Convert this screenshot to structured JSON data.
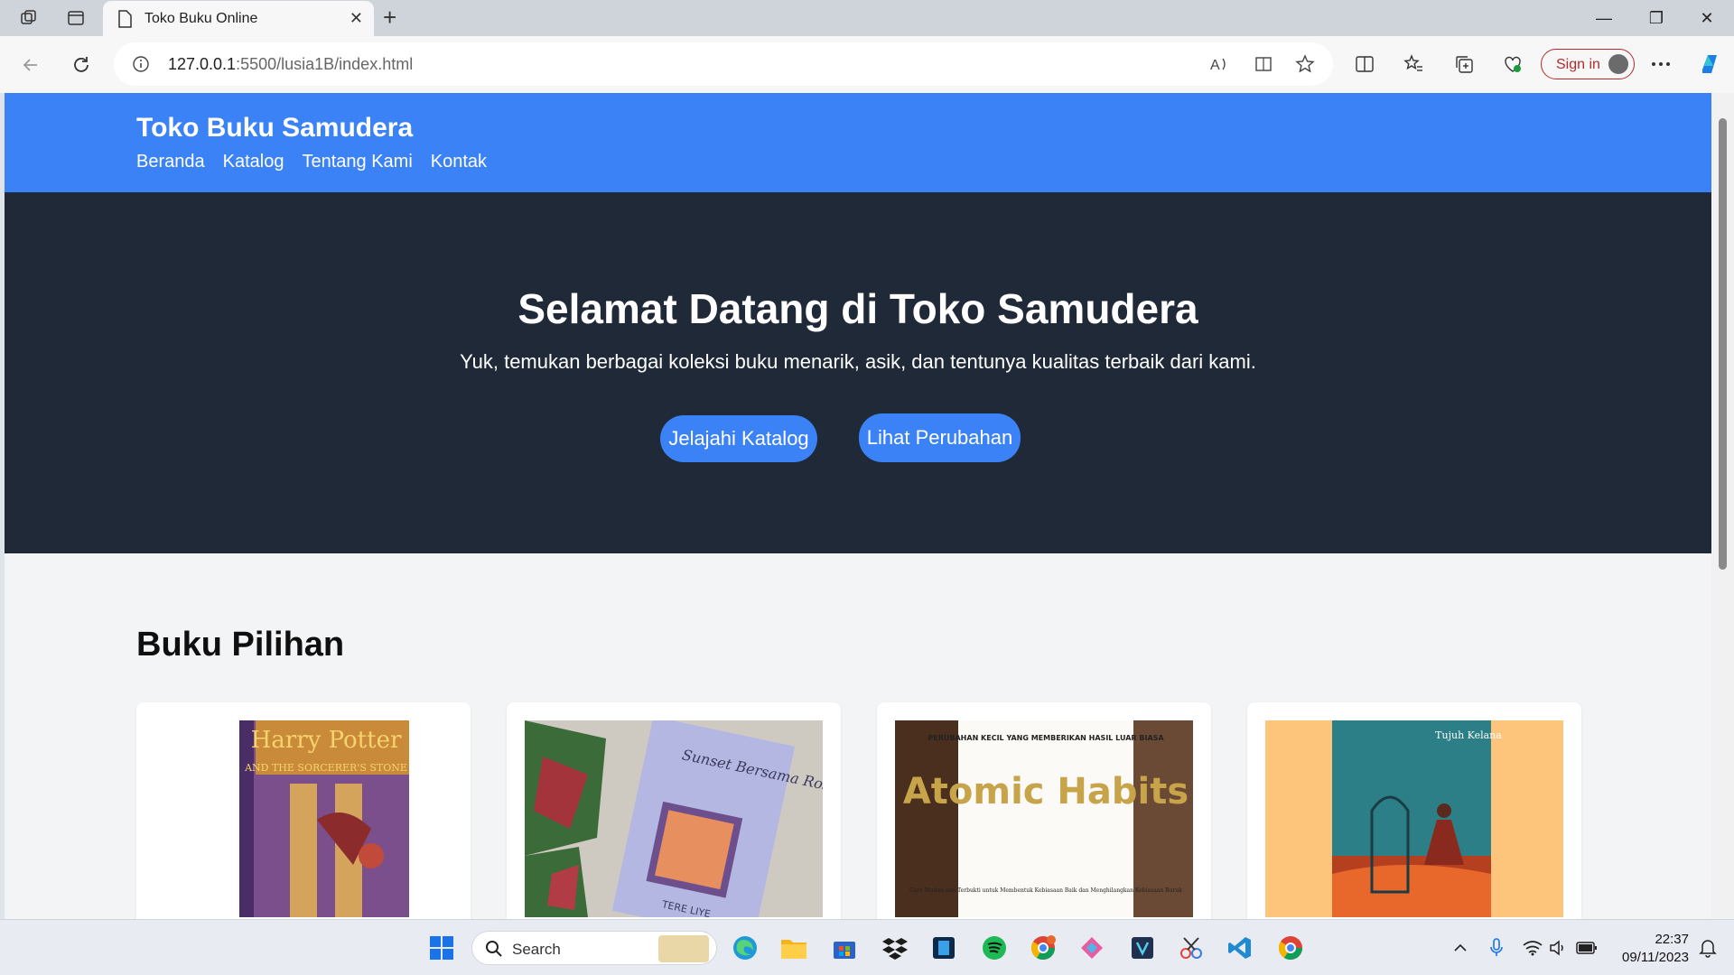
{
  "browser": {
    "tab_title": "Toko Buku Online",
    "url_host": "127.0.0.1",
    "url_rest": ":5500/lusia1B/index.html",
    "signin_label": "Sign in"
  },
  "site": {
    "brand": "Toko Buku Samudera",
    "nav": [
      "Beranda",
      "Katalog",
      "Tentang Kami",
      "Kontak"
    ],
    "hero": {
      "title": "Selamat Datang di Toko Samudera",
      "subtitle": "Yuk, temukan berbagai koleksi buku menarik, asik, dan tentunya kualitas terbaik dari kami.",
      "primary_button": "Jelajahi Katalog",
      "secondary_button": "Lihat Perubahan"
    },
    "section_title": "Buku Pilihan",
    "books": [
      {
        "cover_title": "Harry Potter",
        "cover_subtitle": "AND THE SORCERER'S STONE"
      },
      {
        "cover_title": "Sunset Bersama Rosie",
        "cover_author": "TERE LIYE"
      },
      {
        "cover_tagline": "PERUBAHAN KECIL YANG MEMBERIKAN HASIL LUAR BIASA",
        "cover_title": "Atomic Habits",
        "cover_subtitle": "Cara Mudah dan Terbukti untuk Membentuk Kebiasaan Baik dan Menghilangkan Kebiasaan Buruk"
      },
      {
        "cover_title": "Tujuh Kelana"
      }
    ]
  },
  "taskbar": {
    "search_label": "Search",
    "time": "22:37",
    "date": "09/11/2023"
  },
  "colors": {
    "header": "#3b82f6",
    "hero": "#1f2937",
    "accent": "#3b82f6",
    "page_bg": "#f3f4f6"
  }
}
